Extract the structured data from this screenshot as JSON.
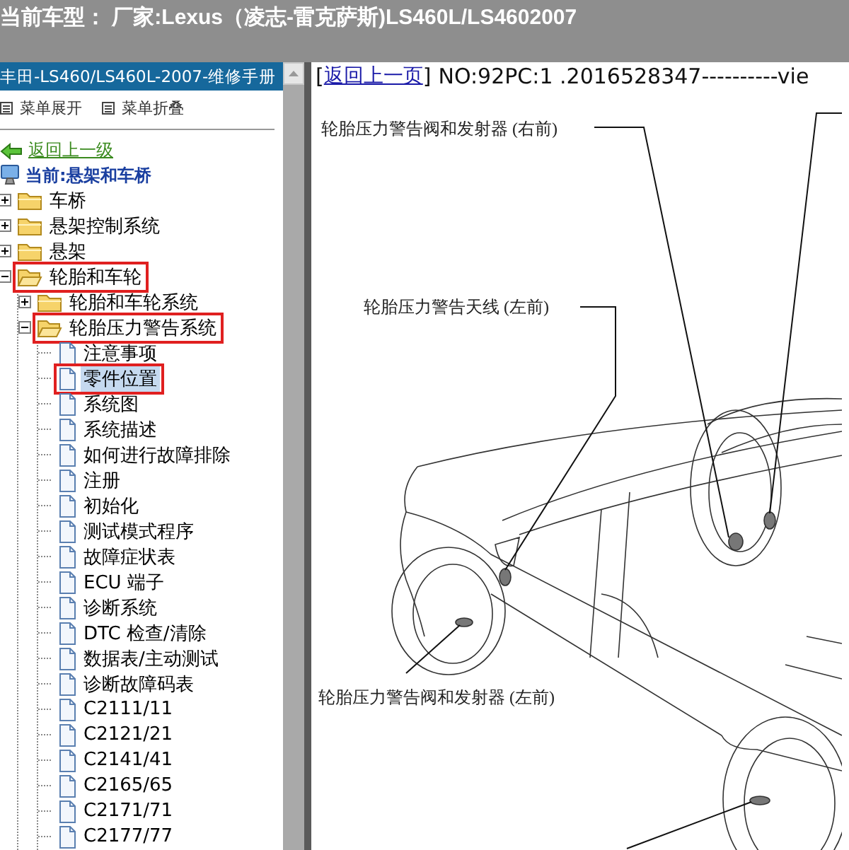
{
  "top_bar": {
    "title": "当前车型： 厂家:Lexus（凌志-雷克萨斯)LS460L/LS4602007"
  },
  "sidebar": {
    "title": "丰田-LS460/LS460L-2007-维修手册",
    "menu": [
      {
        "label": "菜单展开"
      },
      {
        "label": "菜单折叠"
      }
    ],
    "back_link": "返回上一级",
    "current": "当前:悬架和车桥",
    "tree": [
      {
        "label": "车桥",
        "kind": "folder",
        "expanded": false,
        "selected": false,
        "highlighted": false
      },
      {
        "label": "悬架控制系统",
        "kind": "folder",
        "expanded": false,
        "selected": false,
        "highlighted": false
      },
      {
        "label": "悬架",
        "kind": "folder",
        "expanded": false,
        "selected": false,
        "highlighted": false
      },
      {
        "label": "轮胎和车轮",
        "kind": "folder",
        "expanded": true,
        "selected": false,
        "highlighted": true,
        "children": [
          {
            "label": "轮胎和车轮系统",
            "kind": "folder",
            "expanded": false,
            "selected": false,
            "highlighted": false
          },
          {
            "label": "轮胎压力警告系统",
            "kind": "folder",
            "expanded": true,
            "selected": false,
            "highlighted": true,
            "children": [
              {
                "label": "注意事项",
                "kind": "page",
                "selected": false,
                "highlighted": false
              },
              {
                "label": "零件位置",
                "kind": "page",
                "selected": true,
                "highlighted": true
              },
              {
                "label": "系统图",
                "kind": "page",
                "selected": false,
                "highlighted": false
              },
              {
                "label": "系统描述",
                "kind": "page",
                "selected": false,
                "highlighted": false
              },
              {
                "label": "如何进行故障排除",
                "kind": "page",
                "selected": false,
                "highlighted": false
              },
              {
                "label": "注册",
                "kind": "page",
                "selected": false,
                "highlighted": false
              },
              {
                "label": "初始化",
                "kind": "page",
                "selected": false,
                "highlighted": false
              },
              {
                "label": "测试模式程序",
                "kind": "page",
                "selected": false,
                "highlighted": false
              },
              {
                "label": "故障症状表",
                "kind": "page",
                "selected": false,
                "highlighted": false
              },
              {
                "label": "ECU 端子",
                "kind": "page",
                "selected": false,
                "highlighted": false
              },
              {
                "label": "诊断系统",
                "kind": "page",
                "selected": false,
                "highlighted": false
              },
              {
                "label": "DTC 检查/清除",
                "kind": "page",
                "selected": false,
                "highlighted": false
              },
              {
                "label": "数据表/主动测试",
                "kind": "page",
                "selected": false,
                "highlighted": false
              },
              {
                "label": "诊断故障码表",
                "kind": "page",
                "selected": false,
                "highlighted": false
              },
              {
                "label": "C2111/11",
                "kind": "page",
                "selected": false,
                "highlighted": false
              },
              {
                "label": "C2121/21",
                "kind": "page",
                "selected": false,
                "highlighted": false
              },
              {
                "label": "C2141/41",
                "kind": "page",
                "selected": false,
                "highlighted": false
              },
              {
                "label": "C2165/65",
                "kind": "page",
                "selected": false,
                "highlighted": false
              },
              {
                "label": "C2171/71",
                "kind": "page",
                "selected": false,
                "highlighted": false
              },
              {
                "label": "C2177/77",
                "kind": "page",
                "selected": false,
                "highlighted": false
              }
            ]
          }
        ]
      }
    ]
  },
  "document": {
    "bracket_open": "[",
    "back_link": "返回上一页",
    "bracket_close": "]",
    "heading": "NO:92PC:1 .2016528347----------vie",
    "diagram": {
      "callouts": [
        {
          "label": "轮胎压力警告阀和发射器 (右前)"
        },
        {
          "label": "轮胎压力警告天线 (左前)"
        },
        {
          "label": "轮胎压力警告阀和发射器 (左前)"
        }
      ]
    }
  }
}
